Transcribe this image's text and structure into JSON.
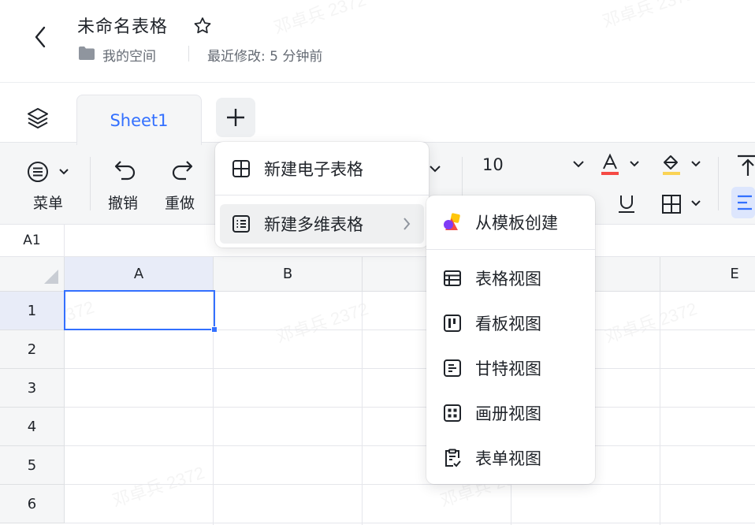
{
  "header": {
    "title": "未命名表格",
    "location": "我的空间",
    "modified": "最近修改: 5 分钟前"
  },
  "tabs": [
    {
      "label": "Sheet1",
      "active": true
    }
  ],
  "toolbar": {
    "menu_label": "菜单",
    "undo_label": "撤销",
    "redo_label": "重做",
    "font_size": "10"
  },
  "formula_bar": {
    "cell_ref": "A1"
  },
  "grid": {
    "columns": [
      "A",
      "B",
      "",
      "",
      "E"
    ],
    "rows": [
      "1",
      "2",
      "3",
      "4",
      "5",
      "6"
    ]
  },
  "new_menu": {
    "items": [
      {
        "label": "新建电子表格",
        "icon": "grid-icon"
      },
      {
        "label": "新建多维表格",
        "icon": "table-list-icon",
        "has_submenu": true
      }
    ]
  },
  "submenu": {
    "template": "从模板创建",
    "views": [
      {
        "label": "表格视图",
        "icon": "table-view-icon"
      },
      {
        "label": "看板视图",
        "icon": "kanban-view-icon"
      },
      {
        "label": "甘特视图",
        "icon": "gantt-view-icon"
      },
      {
        "label": "画册视图",
        "icon": "gallery-view-icon"
      },
      {
        "label": "表单视图",
        "icon": "form-view-icon"
      }
    ]
  },
  "watermark": "邓卓兵 2372",
  "colors": {
    "accent": "#3370ff",
    "text": "#1f2329",
    "secondary": "#646a73"
  }
}
